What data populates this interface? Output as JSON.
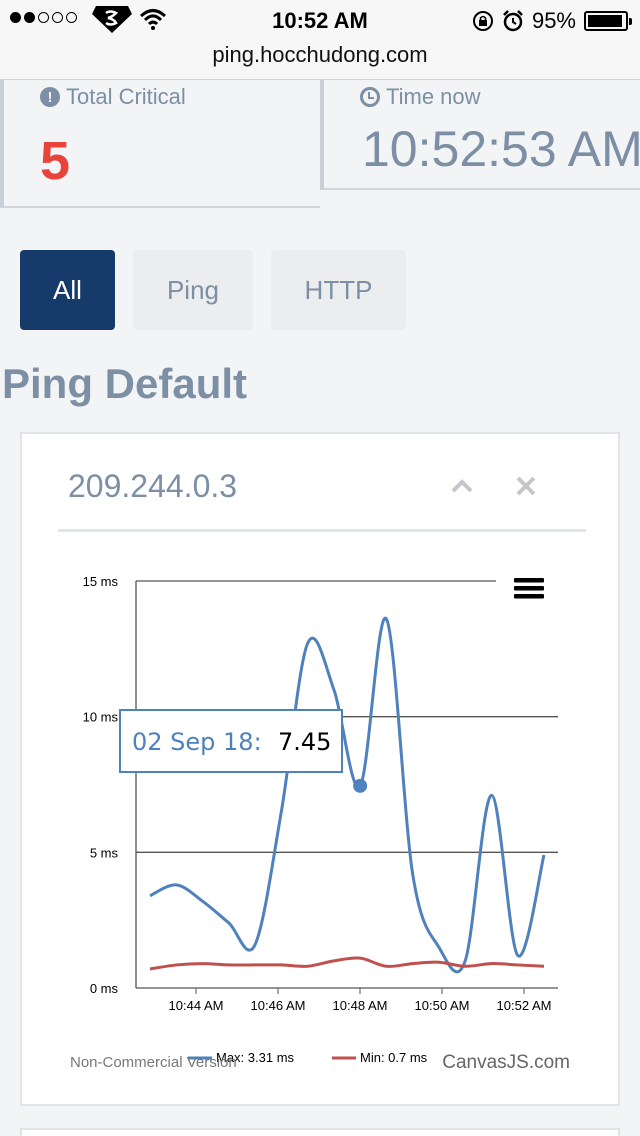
{
  "status": {
    "time": "10:52 AM",
    "battery": "95%",
    "battery_level": 0.95
  },
  "url": "ping.hocchudong.com",
  "stats": {
    "critical": {
      "label": "Total Critical",
      "value": "5"
    },
    "time_now": {
      "label": "Time now",
      "value": "10:52:53 AM"
    }
  },
  "filters": [
    "All",
    "Ping",
    "HTTP"
  ],
  "section_title": "Ping Default",
  "card": {
    "title": "209.244.0.3"
  },
  "chart_data": {
    "type": "line",
    "x": [
      "10:43:00",
      "10:43:30",
      "10:44:00",
      "10:44:30",
      "10:45:00",
      "10:45:30",
      "10:46:00",
      "10:46:30",
      "10:47:00",
      "10:47:30",
      "10:48:00",
      "10:48:30",
      "10:49:00",
      "10:49:30",
      "10:50:00",
      "10:50:30",
      "10:51:00",
      "10:51:30",
      "10:52:00",
      "10:52:30"
    ],
    "series": [
      {
        "name": "Max: 3.31 ms",
        "color": "#4f81bc",
        "values": [
          3.4,
          3.8,
          3.2,
          2.4,
          1.6,
          6.5,
          12.7,
          11.0,
          7.45,
          13.6,
          4.2,
          1.5,
          1.0,
          7.1,
          1.2,
          4.9
        ]
      },
      {
        "name": "Min: 0.7 ms",
        "color": "#c0504e",
        "values": [
          0.7,
          0.85,
          0.9,
          0.85,
          0.85,
          0.85,
          0.8,
          1.0,
          1.1,
          0.8,
          0.9,
          0.95,
          0.8,
          0.9,
          0.85,
          0.8
        ]
      }
    ],
    "x_tick_labels": [
      "10:44 AM",
      "10:46 AM",
      "10:48 AM",
      "10:50 AM",
      "10:52 AM"
    ],
    "y_tick_labels": [
      "0 ms",
      "5 ms",
      "10 ms",
      "15 ms"
    ],
    "ylim": [
      0,
      15
    ],
    "tooltip": {
      "label": "02 Sep 18:",
      "value": "7.45"
    },
    "watermark_left": "Non-Commercial Version",
    "watermark_right": "CanvasJS.com"
  }
}
